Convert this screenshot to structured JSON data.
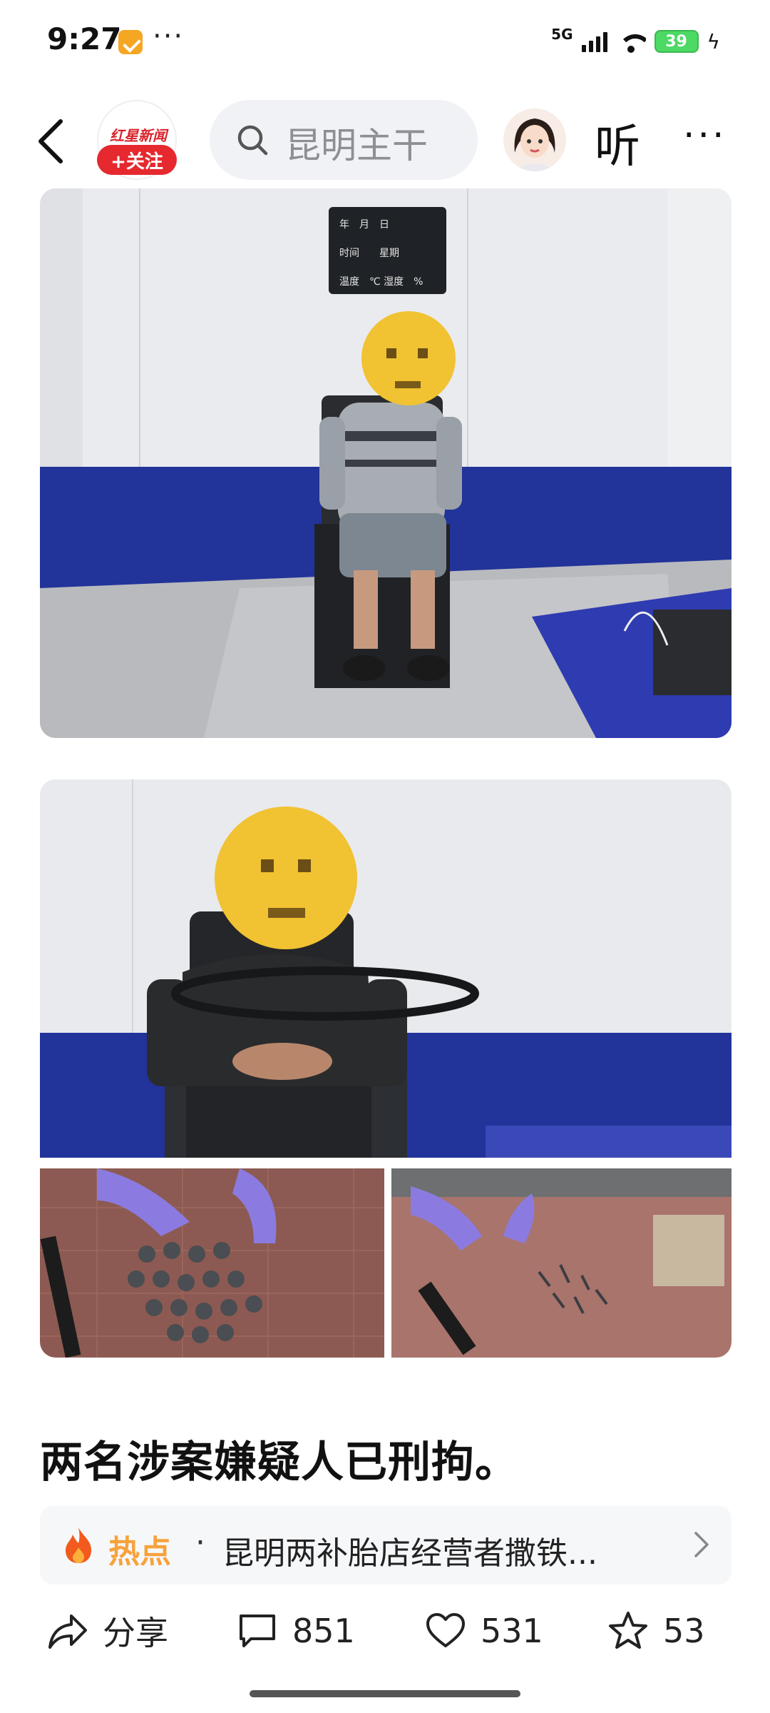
{
  "status_bar": {
    "time": "9:27",
    "more": "···",
    "network": "5G",
    "battery": "39",
    "icons": [
      "app-notification-icon",
      "signal-icon",
      "wifi-icon",
      "battery-icon",
      "charging-icon"
    ]
  },
  "header": {
    "account_logo": "红星新闻",
    "follow_label": "+关注",
    "search_text": "昆明主干",
    "listen_label": "听",
    "more_label": "···"
  },
  "images": [
    {
      "description_kind": "photo",
      "placard_lines": [
        "年　月　日",
        "时间　　星期",
        "温度　℃ 湿度　%"
      ]
    },
    {
      "description_kind": "photo"
    }
  ],
  "caption": "两名涉案嫌疑人已刑拘。",
  "hot_topic": {
    "label": "热点",
    "separator": "·",
    "text": "昆明两补胎店经营者撒铁..."
  },
  "actions": {
    "share": "分享",
    "comments": "851",
    "likes": "531",
    "favorites": "53"
  },
  "colors": {
    "follow": "#e5292f",
    "hot": "#f7a23b",
    "wall_blue": "#22339a"
  }
}
